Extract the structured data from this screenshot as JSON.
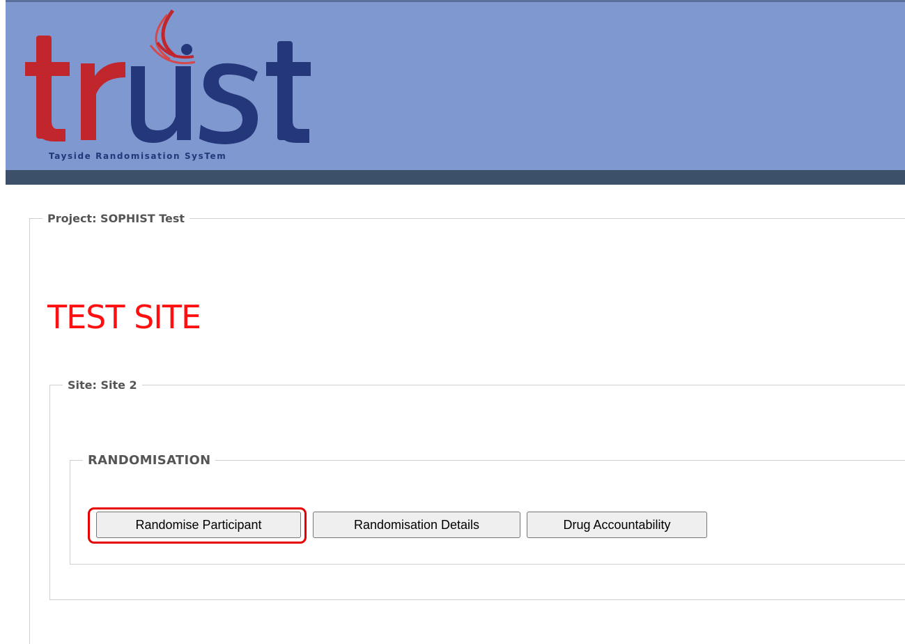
{
  "header": {
    "logo_text": "trust",
    "logo_tagline": "Tayside Randomisation SysTem",
    "colors": {
      "band": "#7f99d0",
      "strip": "#3c5069",
      "logo_red": "#c0262c",
      "logo_blue": "#23377a"
    }
  },
  "project": {
    "legend": "Project: SOPHIST Test"
  },
  "site_title": "TEST SITE",
  "site": {
    "legend": "Site: Site 2"
  },
  "randomisation": {
    "legend": "RANDOMISATION",
    "buttons": {
      "randomise": "Randomise Participant",
      "details": "Randomisation Details",
      "drug": "Drug Accountability"
    }
  },
  "highlight_color": "#e60000"
}
